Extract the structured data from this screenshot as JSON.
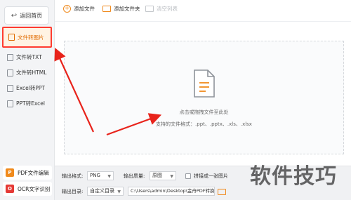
{
  "sidebar": {
    "back_label": "返回首页",
    "items": [
      {
        "label": "文件转图片",
        "active": true
      },
      {
        "label": "文件转TXT"
      },
      {
        "label": "文件转HTML"
      },
      {
        "label": "Excel转PPT"
      },
      {
        "label": "PPT转Excel"
      }
    ],
    "tools": [
      {
        "label": "PDF文件编辑",
        "badge": "P",
        "color": "#f08a1c"
      },
      {
        "label": "OCR文字识别",
        "badge": "O",
        "color": "#e53935"
      }
    ]
  },
  "toolbar": {
    "add_file": "添加文件",
    "add_folder": "添加文件夹",
    "clear_list": "清空列表"
  },
  "drop_zone": {
    "hint": "点击或拖拽文件至此处",
    "formats": "支持的文件格式：.ppt、.pptx、.xls、.xlsx"
  },
  "bottom": {
    "format_label": "输出格式:",
    "format_value": "PNG",
    "quality_label": "输出质量:",
    "quality_value": "原图",
    "merge_label": "拼接成一张图片",
    "dir_label": "输出目录:",
    "dir_value": "自定义目录",
    "path_value": "C:\\Users\\admin\\Desktop\\金舟PDF转换"
  },
  "watermark": "软件技巧",
  "colors": {
    "accent": "#f08a1c",
    "highlight": "#ff3b30"
  }
}
